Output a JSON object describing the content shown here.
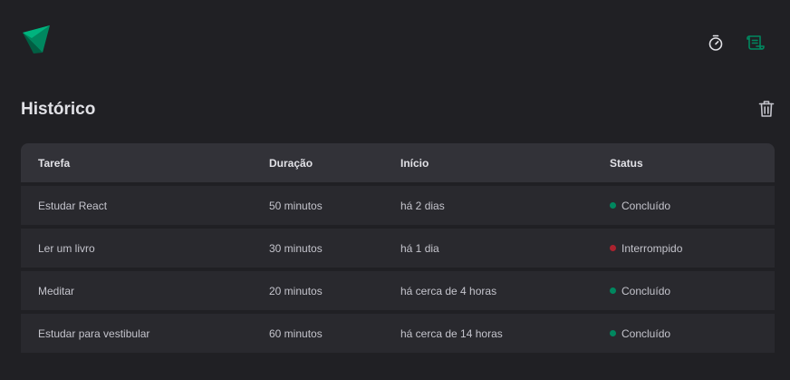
{
  "header": {
    "logo_icon": "app-logo-triangle",
    "nav": [
      {
        "name": "timer-nav-button",
        "icon": "timer-icon",
        "active": false
      },
      {
        "name": "history-nav-button",
        "icon": "scroll-icon",
        "active": true
      }
    ]
  },
  "page": {
    "title": "Histórico",
    "trash_icon": "trash-icon"
  },
  "table": {
    "columns": [
      "Tarefa",
      "Duração",
      "Início",
      "Status"
    ],
    "rows": [
      {
        "task": "Estudar React",
        "duration": "50 minutos",
        "start": "há 2 dias",
        "status": "Concluído",
        "status_color": "#00875f"
      },
      {
        "task": "Ler um livro",
        "duration": "30 minutos",
        "start": "há 1 dia",
        "status": "Interrompido",
        "status_color": "#ab222e"
      },
      {
        "task": "Meditar",
        "duration": "20 minutos",
        "start": "há cerca de 4 horas",
        "status": "Concluído",
        "status_color": "#00875f"
      },
      {
        "task": "Estudar para vestibular",
        "duration": "60 minutos",
        "start": "há cerca de 14 horas",
        "status": "Concluído",
        "status_color": "#00875f"
      }
    ]
  },
  "colors": {
    "background": "#202024",
    "header_row": "#323238",
    "row": "#29292e",
    "accent": "#00875f",
    "danger": "#ab222e"
  }
}
